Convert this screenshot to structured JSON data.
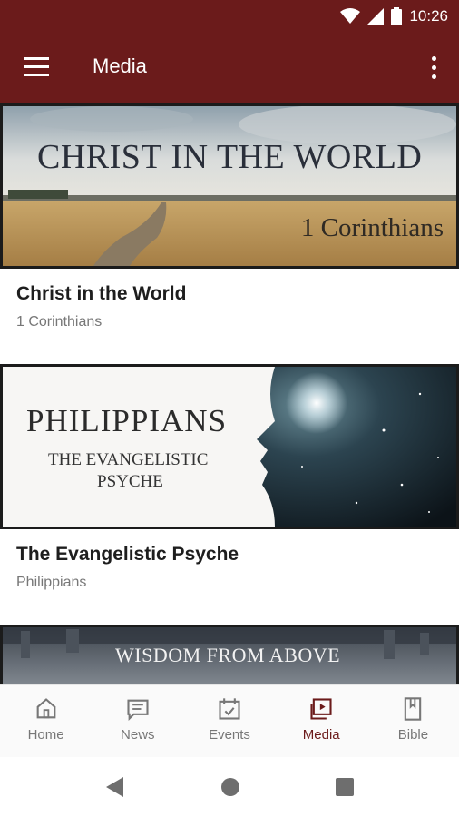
{
  "status_bar": {
    "time": "10:26"
  },
  "app_bar": {
    "title": "Media"
  },
  "cards": [
    {
      "banner_title": "CHRIST IN THE WORLD",
      "banner_subtitle": "1 Corinthians",
      "title": "Christ in the World",
      "subtitle": "1 Corinthians"
    },
    {
      "banner_title": "PHILIPPIANS",
      "banner_subtitle_line1": "THE EVANGELISTIC",
      "banner_subtitle_line2": "PSYCHE",
      "title": "The Evangelistic Psyche",
      "subtitle": "Philippians"
    },
    {
      "banner_title": "WISDOM FROM ABOVE"
    }
  ],
  "bottom_nav": {
    "items": [
      {
        "label": "Home",
        "icon": "home-icon",
        "active": false
      },
      {
        "label": "News",
        "icon": "news-icon",
        "active": false
      },
      {
        "label": "Events",
        "icon": "events-icon",
        "active": false
      },
      {
        "label": "Media",
        "icon": "media-icon",
        "active": true
      },
      {
        "label": "Bible",
        "icon": "bible-icon",
        "active": false
      }
    ]
  },
  "colors": {
    "primary": "#6b1b1b",
    "inactive": "#777777"
  }
}
